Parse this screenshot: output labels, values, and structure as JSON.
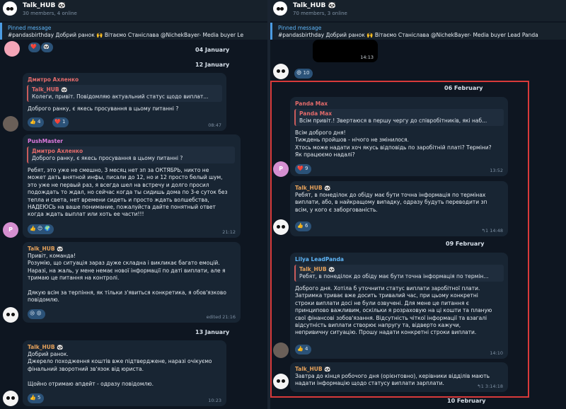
{
  "left": {
    "header": {
      "title": "Talk_HUB 🐼",
      "subtitle": "30 members, 4 online"
    },
    "pinned": {
      "label": "Pinned message",
      "text": "#pandasbirthday  Добрий ранок 🙌 Вітаємо Станіслава @NichekBayer- Media buyer  Le"
    },
    "top_reacts": {
      "a": "❤️",
      "b": "🐼"
    },
    "date1": "04 January",
    "date2": "12 January",
    "date3": "13 January",
    "m1": {
      "sender": "Дмитро Ахленко",
      "quote_sender": "Talk_HUB 🐼",
      "quote_text": "Колеги, привіт.  Повідомляю актуальний статус щодо виплат...",
      "text": "Доброго ранку, є якесь просування в цьому питанні ?",
      "r1": "👍 4",
      "r2": "❤️ 1",
      "time": "08:47"
    },
    "m2": {
      "sender": "PushMaster",
      "quote_sender": "Дмитро Ахленко",
      "quote_text": "Доброго ранку, є якесь просування в цьому питанні ?",
      "lines": [
        "Ребят, это уже не смешно, 3 месяц нет зп за ОКТЯБРЬ, никто не",
        "может дать внятной инфы, писали до 12, но и 12 просто белый шум,",
        "это уже не первый раз, я всегда шел на встречу и долго просил",
        "подождать то ждал, но сейчас когда ты сидишь дома по 3-е суток без",
        "тепла и света, нет времени сидеть и просто ждать волшебства,",
        "НАДЕЮСЬ на ваше понимание, пожалуйста дайте понятный ответ",
        "когда ждать выплат или хоть ее части!!!"
      ],
      "reacts": "👍 😊 🌍",
      "time": "21:12",
      "avatar": "P"
    },
    "m3": {
      "sender": "Talk_HUB 🐼",
      "lines": [
        "Привіт, команда!",
        "Розумію, що ситуація зараз дуже складна і викликає багато емоцій.",
        "Наразі, на жаль, у мене немає нової інформації по даті виплати, але я",
        "тримаю це питання на контролі.",
        "",
        "Дякую всім за терпіння, як тільки з'явиться конкретика, я обов'язково",
        "повідомлю."
      ],
      "reacts": "😢 😡",
      "time": "edited 21:16"
    },
    "m4": {
      "sender": "Talk_HUB 🐼",
      "lines": [
        "Добрий ранок.",
        "Джерело походження коштів вже підтверджене, наразі очікуємо",
        "фінальний зворотний зв'язок від юриста.",
        "",
        "Щойно отримаю апдейт - одразу повідомлю."
      ],
      "reacts": "👍 5",
      "time": "10:23"
    }
  },
  "right": {
    "header": {
      "title": "Talk_HUB 🐼",
      "subtitle": "70 members, 3 online"
    },
    "pinned": {
      "label": "Pinned message",
      "text": "#pandasbirthday  Добрий ранок 🙌 Вітаємо Станіслава @NichekBayer- Media buyer  Lead Panda"
    },
    "top_time": "14:13",
    "top_react": "😄 10",
    "date1": "06 February",
    "date2": "09 February",
    "date3": "10 February",
    "m1": {
      "sender": "Panda Max",
      "quote_sender": "Panda Max",
      "quote_text": "Всім привіт.!  Звертаюся в першу чергу до співробітників, які наб...",
      "lines": [
        "Всім доброго дня!",
        "Тиждень пройшов - нічого не змінилося.",
        "Хтось може надати хоч якусь відповідь по заробітній платі? Терміни?",
        "Як працюємо надалі?"
      ],
      "reacts": "❤️ 9",
      "time": "13:52",
      "avatar": "P"
    },
    "m2": {
      "sender": "Talk_HUB 🐼",
      "lines": [
        "Ребят, в понеділок до обіду має бути точна інформація по термінах",
        "виплати, або, в найкращому випадку, одразу будуть переводити зп",
        "всім, у кого є заборгованість."
      ],
      "reacts": "👍 6",
      "time": "↰1 14:48"
    },
    "m3": {
      "sender": "Lilya LeadPanda",
      "quote_sender": "Talk_HUB 🐼",
      "quote_text": "Ребят, в понеділок до обіду має бути точна інформація по термін...",
      "lines": [
        "Доброго дня. Хотіла б уточнити статус виплати заробітної плати.",
        "Затримка триває вже досить тривалий час, при цьому конкретні",
        "строки виплати досі не були озвучені. Для мене це питання є",
        "принципово важливим, оскільки я розраховую на ці кошти та планую",
        "свої фінансові зобов'язання. Відсутність чіткої інформації та взагалі",
        "відсутність виплати створює напругу та, відверто кажучи,",
        "непривичну ситуацію. Прошу надати конкретні строки виплати."
      ],
      "reacts": "👍 4",
      "time": "14:10"
    },
    "m4": {
      "sender": "Talk_HUB 🐼",
      "lines": [
        "Завтра до кінця робочого дня (орієнтовно), керівники відділів мають",
        "надати інформацію щодо статусу виплати зарплати."
      ],
      "time": "↰1 3:14:18"
    }
  },
  "colors": {
    "accent": "#4c9ce2",
    "highlight": "#d83a3a",
    "bubble": "#182533",
    "bg": "#0e1621"
  }
}
